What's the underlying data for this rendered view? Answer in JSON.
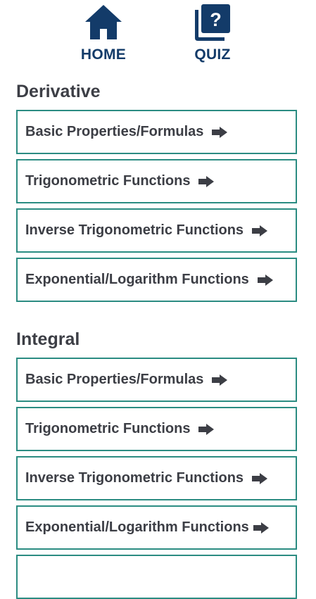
{
  "nav": {
    "home_label": "HOME",
    "quiz_label": "QUIZ",
    "quiz_glyph": "?"
  },
  "sections": [
    {
      "title": "Derivative",
      "items": [
        "Basic Properties/Formulas",
        "Trigonometric Functions",
        "Inverse Trigonometric Functions",
        "Exponential/Logarithm Functions"
      ]
    },
    {
      "title": "Integral",
      "items": [
        "Basic Properties/Formulas",
        "Trigonometric Functions",
        "Inverse Trigonometric Functions",
        "Exponential/Logarithm Functions"
      ]
    }
  ],
  "colors": {
    "brand": "#133b69",
    "border": "#2b8c82",
    "text": "#3c3e45"
  },
  "icons": {
    "home": "home-icon",
    "quiz": "quiz-icon",
    "arrow": "arrow-right-icon"
  }
}
